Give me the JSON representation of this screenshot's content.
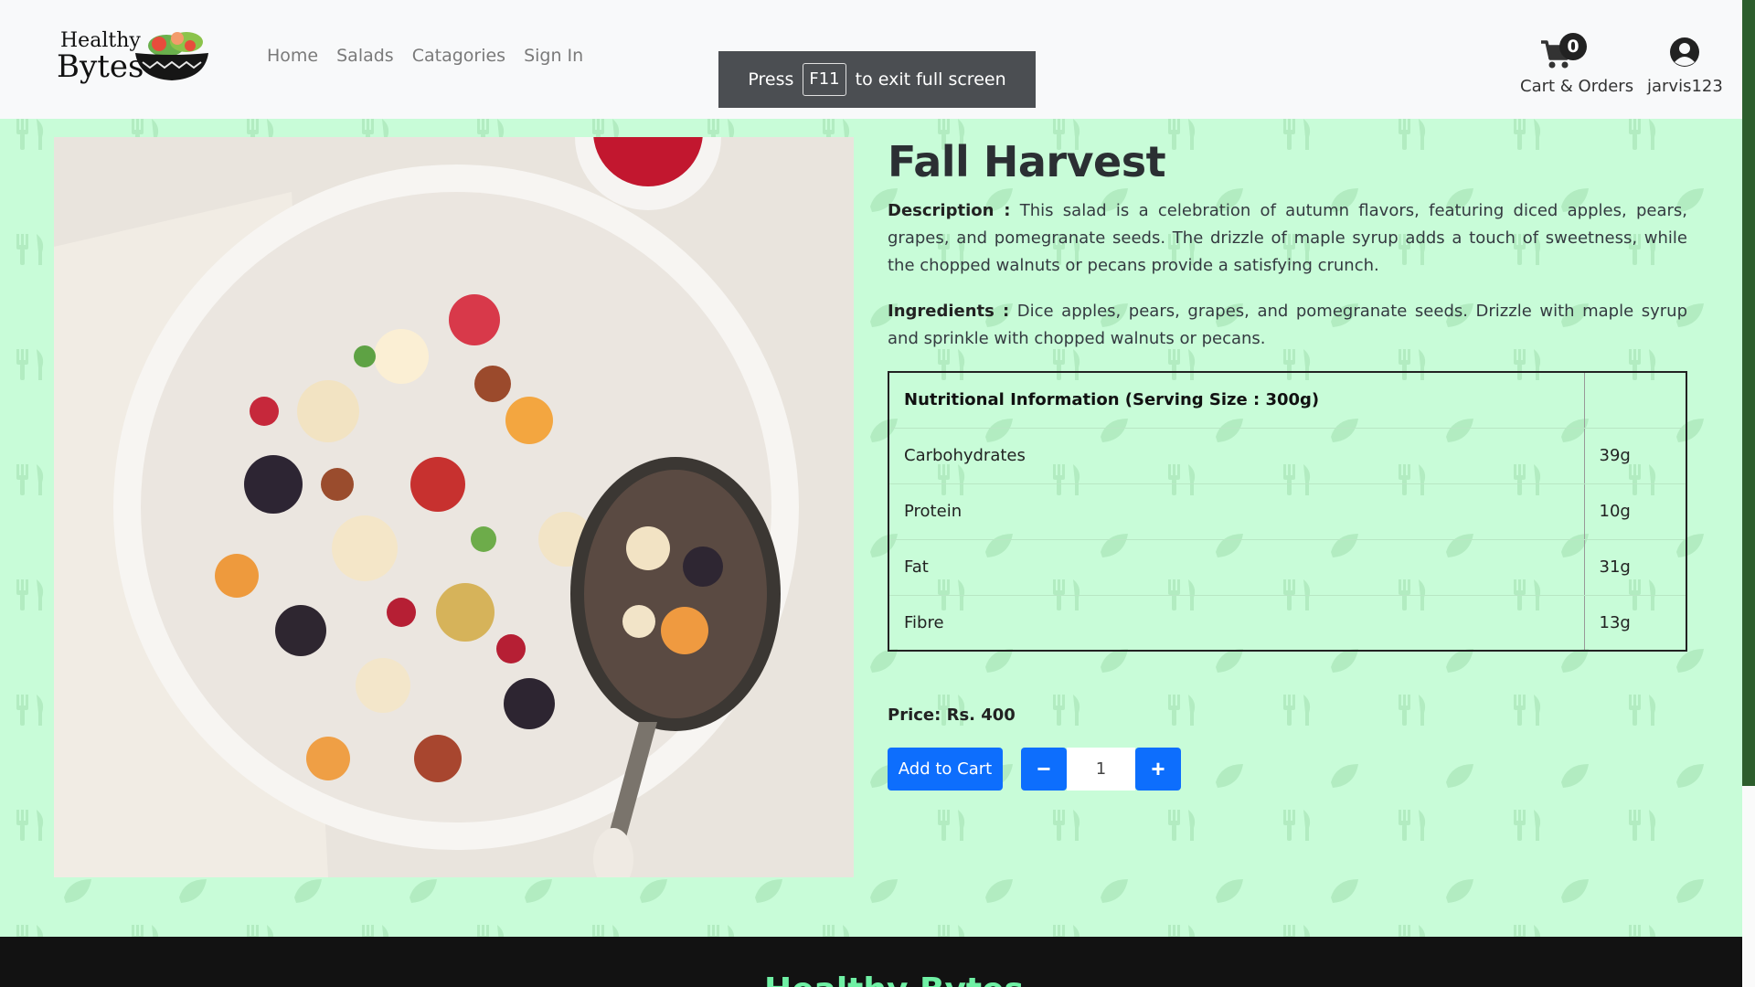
{
  "brand": {
    "line1": "Healthy",
    "line2": "Bytes"
  },
  "nav": {
    "items": [
      "Home",
      "Salads",
      "Catagories",
      "Sign In"
    ]
  },
  "fullscreen_toast": {
    "pre": "Press",
    "key": "F11",
    "post": "to exit full screen"
  },
  "cart": {
    "count": "0",
    "label": "Cart & Orders"
  },
  "user": {
    "name": "jarvis123"
  },
  "product": {
    "title": "Fall Harvest",
    "description_label": "Description :",
    "description": "This salad is a celebration of autumn flavors, featuring diced apples, pears, grapes, and pomegranate seeds. The drizzle of maple syrup adds a touch of sweetness, while the chopped walnuts or pecans provide a satisfying crunch.",
    "ingredients_label": "Ingredients :",
    "ingredients": "Dice apples, pears, grapes, and pomegranate seeds. Drizzle with maple syrup and sprinkle with chopped walnuts or pecans.",
    "nutrition": {
      "header": "Nutritional Information (Serving Size : 300g)",
      "rows": [
        {
          "name": "Carbohydrates",
          "value": "39g"
        },
        {
          "name": "Protein",
          "value": "10g"
        },
        {
          "name": "Fat",
          "value": "31g"
        },
        {
          "name": "Fibre",
          "value": "13g"
        }
      ]
    },
    "price": "Price: Rs. 400",
    "add_to_cart_label": "Add to Cart",
    "quantity": "1",
    "minus_symbol": "−",
    "plus_symbol": "+"
  },
  "footer": {
    "brand": "Healthy Bytes"
  },
  "colors": {
    "background": "#c8fcd8",
    "navbar": "#f8f9fa",
    "primary": "#0d6efd",
    "footer": "#121212",
    "footer_brand": "#6ff0a4"
  },
  "icons": [
    "cart-icon",
    "user-circle-icon",
    "salad-bowl-icon",
    "minus-icon",
    "plus-icon"
  ]
}
